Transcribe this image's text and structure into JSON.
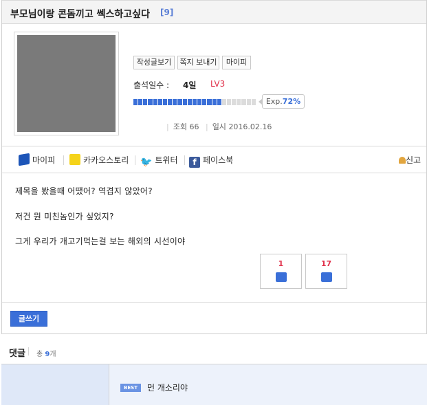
{
  "post": {
    "title": "부모님이랑 콘돔끼고 쎅스하고싶다",
    "comment_count_tag": "[9]"
  },
  "profile": {
    "buttons": {
      "write": "작성글보기",
      "message": "쪽지 보내기",
      "mypi": "마이피"
    },
    "attend_label": "출석일수 :",
    "attend_value": "4일",
    "level": "LV3",
    "exp_label": "Exp.",
    "exp_percent": "72%",
    "exp_fraction": 0.72,
    "views_label": "조회",
    "views": "66",
    "date_label": "일시",
    "date": "2016.02.16"
  },
  "share": {
    "mypi": "마이피",
    "kakao": "카카오스토리",
    "twitter": "트위터",
    "facebook": "페이스북",
    "report": "신고"
  },
  "body": {
    "lines": [
      "제목을 봤을때 어땠어? 역겹지 않았어?",
      "저건 뭔 미친놈인가 싶었지?",
      "그게 우리가 개고기먹는걸 보는 해외의 시선이야"
    ]
  },
  "votes": {
    "up": "1",
    "down": "17"
  },
  "write_button": "글쓰기",
  "comments": {
    "heading": "댓글",
    "total_label": "총",
    "total": "9",
    "unit": "개",
    "best_badge": "BEST",
    "first_text": "먼 개소리야"
  },
  "colors": {
    "accent": "#3a6fd8",
    "level": "#e0304a",
    "best_bg": "#edf2fb"
  }
}
